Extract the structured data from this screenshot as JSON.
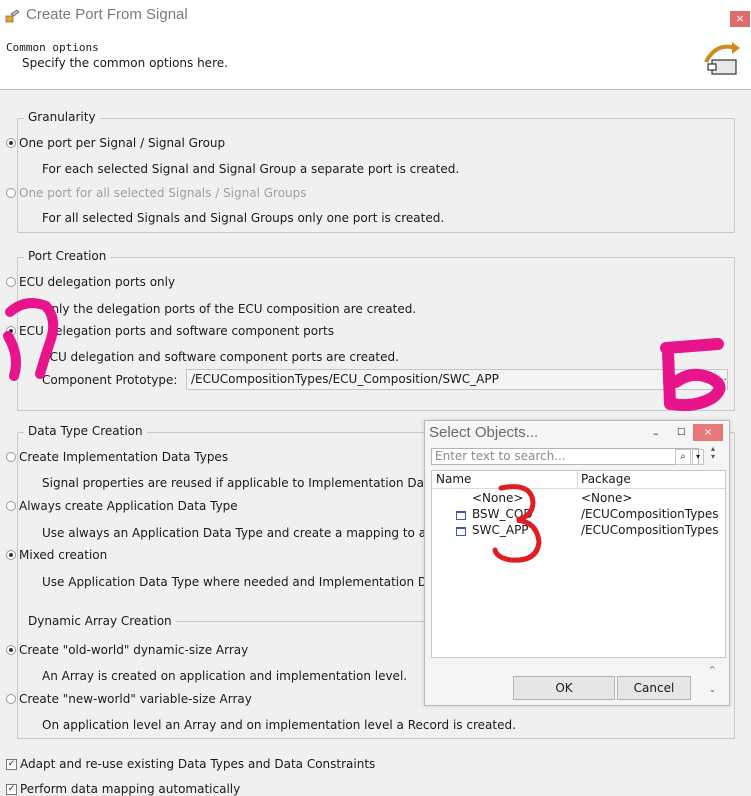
{
  "window": {
    "title": "Create Port From Signal",
    "close_glyph": "×"
  },
  "header": {
    "title": "Common options",
    "subtitle": "Specify the common options here."
  },
  "granularity": {
    "legend": "Granularity",
    "option1": "One port per Signal / Signal Group",
    "desc1": "For each selected Signal and Signal Group a separate port is created.",
    "option2": "One port for all selected Signals / Signal Groups",
    "desc2": "For all selected Signals and Signal Groups only one port is created.",
    "selected": 1
  },
  "port_creation": {
    "legend": "Port Creation",
    "option1": "ECU delegation ports only",
    "desc1": "Only the delegation ports of the ECU composition are created.",
    "option2": "ECU delegation ports and software component ports",
    "desc2": "ECU delegation and software component ports are created.",
    "component_label": "Component Prototype:",
    "component_value": "/ECUCompositionTypes/ECU_Composition/SWC_APP",
    "browse_label": "...",
    "selected": 2
  },
  "data_type_creation": {
    "legend": "Data Type Creation",
    "option1": "Create Implementation Data Types",
    "desc1": "Signal properties are reused if applicable to Implementation Data Types.",
    "option2": "Always create Application Data Type",
    "desc2": "Use always an Application Data Type and create a mapping to an accord",
    "option3": "Mixed creation",
    "desc3": "Use Application Data Type where needed and Implementation Data Type",
    "selected": 3
  },
  "dynamic_array": {
    "legend": "Dynamic Array Creation",
    "option1": "Create \"old-world\" dynamic-size Array",
    "desc1": "An Array is created on application and implementation level.",
    "option2": "Create \"new-world\" variable-size Array",
    "desc2": "On application level an Array and on implementation level a Record is created.",
    "selected": 1
  },
  "checkboxes": {
    "adapt": "Adapt and re-use existing Data Types and Data Constraints",
    "adapt_checked": true,
    "mapping": "Perform data mapping automatically",
    "mapping_checked": true
  },
  "select_dialog": {
    "title": "Select Objects...",
    "min_glyph": "–",
    "max_glyph": "□",
    "close_glyph": "×",
    "search_placeholder": "Enter text to search...",
    "col_name": "Name",
    "col_package": "Package",
    "rows": [
      {
        "name": "<None>",
        "package": "<None>"
      },
      {
        "name": "BSW_COD",
        "package": "/ECUCompositionTypes"
      },
      {
        "name": "SWC_APP",
        "package": "/ECUCompositionTypes"
      }
    ],
    "ok_label": "OK",
    "cancel_label": "Cancel"
  },
  "annotations": {
    "mark1": "1",
    "mark2": "2",
    "mark3": "3",
    "mark_color_pink": "#e8148c",
    "mark_color_red": "#e01c24"
  }
}
